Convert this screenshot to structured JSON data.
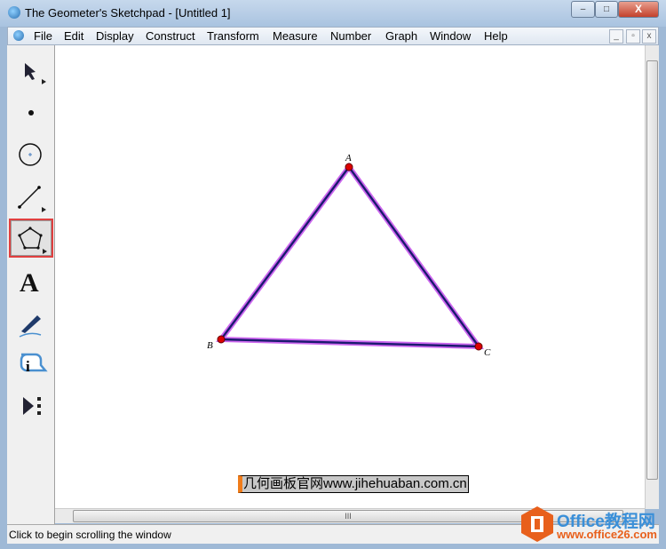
{
  "window": {
    "title": "The Geometer's Sketchpad - [Untitled 1]",
    "minimize": "–",
    "maximize": "□",
    "close": "X"
  },
  "menubar": {
    "items": [
      "File",
      "Edit",
      "Display",
      "Construct",
      "Transform",
      "Measure",
      "Number",
      "Graph",
      "Window",
      "Help"
    ],
    "mdi_min": "_",
    "mdi_restore": "▫",
    "mdi_close": "x"
  },
  "toolbox": {
    "tools": [
      "arrow-tool",
      "point-tool",
      "compass-tool",
      "straightedge-tool",
      "polygon-tool",
      "text-tool",
      "marker-tool",
      "information-tool",
      "custom-tool"
    ],
    "selected": "polygon-tool",
    "highlight_color": "#e04040"
  },
  "sketch": {
    "points": [
      {
        "label": "A"
      },
      {
        "label": "B"
      },
      {
        "label": "C"
      }
    ],
    "edge_color": "#1a1a6e",
    "highlight_color": "#cc66ee",
    "point_color": "#dd0000"
  },
  "caption": "几何画板官网www.jihehuaban.com.cn",
  "status": "Click to begin scrolling the window",
  "watermark": {
    "brand": "Office教程网",
    "url": "www.office26.com",
    "color": "#e8601c"
  }
}
